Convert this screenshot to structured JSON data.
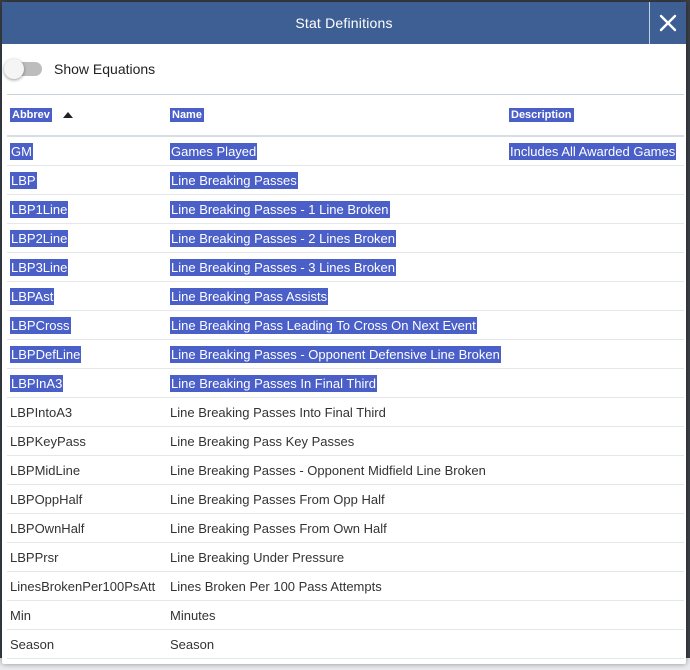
{
  "dialog": {
    "title": "Stat Definitions",
    "close_icon": "close-icon"
  },
  "toolbar": {
    "toggle_label": "Show Equations",
    "toggle_on": false
  },
  "table": {
    "headers": {
      "abbrev": "Abbrev",
      "name": "Name",
      "description": "Description"
    },
    "sort": {
      "column": "abbrev",
      "direction": "ascending",
      "icon": "sort-asc-icon"
    },
    "rows": [
      {
        "abbrev": "GM",
        "name": "Games Played",
        "description": "Includes All Awarded Games",
        "selected": true
      },
      {
        "abbrev": "LBP",
        "name": "Line Breaking Passes",
        "description": "",
        "selected": true
      },
      {
        "abbrev": "LBP1Line",
        "name": "Line Breaking Passes - 1 Line Broken",
        "description": "",
        "selected": true
      },
      {
        "abbrev": "LBP2Line",
        "name": "Line Breaking Passes - 2 Lines Broken",
        "description": "",
        "selected": true
      },
      {
        "abbrev": "LBP3Line",
        "name": "Line Breaking Passes - 3 Lines Broken",
        "description": "",
        "selected": true
      },
      {
        "abbrev": "LBPAst",
        "name": "Line Breaking Pass Assists",
        "description": "",
        "selected": true
      },
      {
        "abbrev": "LBPCross",
        "name": "Line Breaking Pass Leading To Cross On Next Event",
        "description": "",
        "selected": true
      },
      {
        "abbrev": "LBPDefLine",
        "name": "Line Breaking Passes - Opponent Defensive Line Broken",
        "description": "",
        "selected": true
      },
      {
        "abbrev": "LBPInA3",
        "name": "Line Breaking Passes In Final Third",
        "description": "",
        "selected": true
      },
      {
        "abbrev": "LBPIntoA3",
        "name": "Line Breaking Passes Into Final Third",
        "description": "",
        "selected": false
      },
      {
        "abbrev": "LBPKeyPass",
        "name": "Line Breaking Pass Key Passes",
        "description": "",
        "selected": false
      },
      {
        "abbrev": "LBPMidLine",
        "name": "Line Breaking Passes - Opponent Midfield Line Broken",
        "description": "",
        "selected": false
      },
      {
        "abbrev": "LBPOppHalf",
        "name": "Line Breaking Passes From Opp Half",
        "description": "",
        "selected": false
      },
      {
        "abbrev": "LBPOwnHalf",
        "name": "Line Breaking Passes From Own Half",
        "description": "",
        "selected": false
      },
      {
        "abbrev": "LBPPrsr",
        "name": "Line Breaking Under Pressure",
        "description": "",
        "selected": false
      },
      {
        "abbrev": "LinesBrokenPer100PsAtt",
        "name": "Lines Broken Per 100 Pass Attempts",
        "description": "",
        "selected": false
      },
      {
        "abbrev": "Min",
        "name": "Minutes",
        "description": "",
        "selected": false
      },
      {
        "abbrev": "Season",
        "name": "Season",
        "description": "",
        "selected": false
      }
    ]
  },
  "colors": {
    "header_bg": "#3e5f94",
    "selection": "#4a5fc7"
  }
}
